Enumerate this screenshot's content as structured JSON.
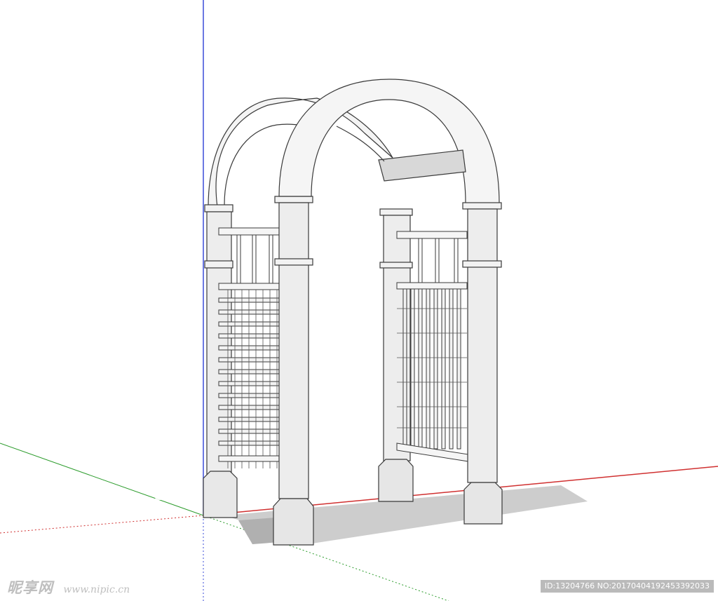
{
  "viewport": {
    "axes": {
      "blue": "#3a4bd8",
      "green": "#2c9c2c",
      "red": "#d03030"
    },
    "model": {
      "fill": "#f2f2f2",
      "shade": "#d2d2d2",
      "stroke": "#3a3a3a",
      "shadow": "#bdbdbd"
    }
  },
  "watermark": {
    "brand": "昵享网",
    "url": "www.nipic.cn",
    "id_text": "ID:13204766 NO:20170404192453392033"
  }
}
